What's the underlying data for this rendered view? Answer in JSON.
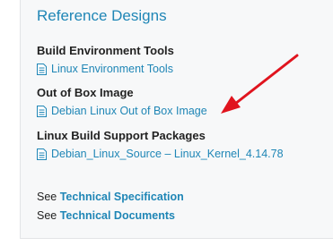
{
  "reference": {
    "title": "Reference Designs",
    "sections": [
      {
        "heading": "Build Environment Tools",
        "link": "Linux Environment Tools",
        "link_icon": "document-icon"
      },
      {
        "heading": "Out of Box Image",
        "link": "Debian Linux Out of Box Image",
        "link_icon": "document-icon"
      },
      {
        "heading": "Linux Build Support Packages",
        "link": "Debian_Linux_Source – Linux_Kernel_4.14.78",
        "link_icon": "document-icon"
      }
    ],
    "see_rows": [
      {
        "prefix": "See",
        "link": "Technical Specification"
      },
      {
        "prefix": "See",
        "link": "Technical Documents"
      }
    ]
  },
  "annotation": {
    "arrow_color": "#e0141e"
  },
  "colors": {
    "link": "#1f86b6",
    "heading": "#222222",
    "card_background": "#f7f8f9"
  }
}
